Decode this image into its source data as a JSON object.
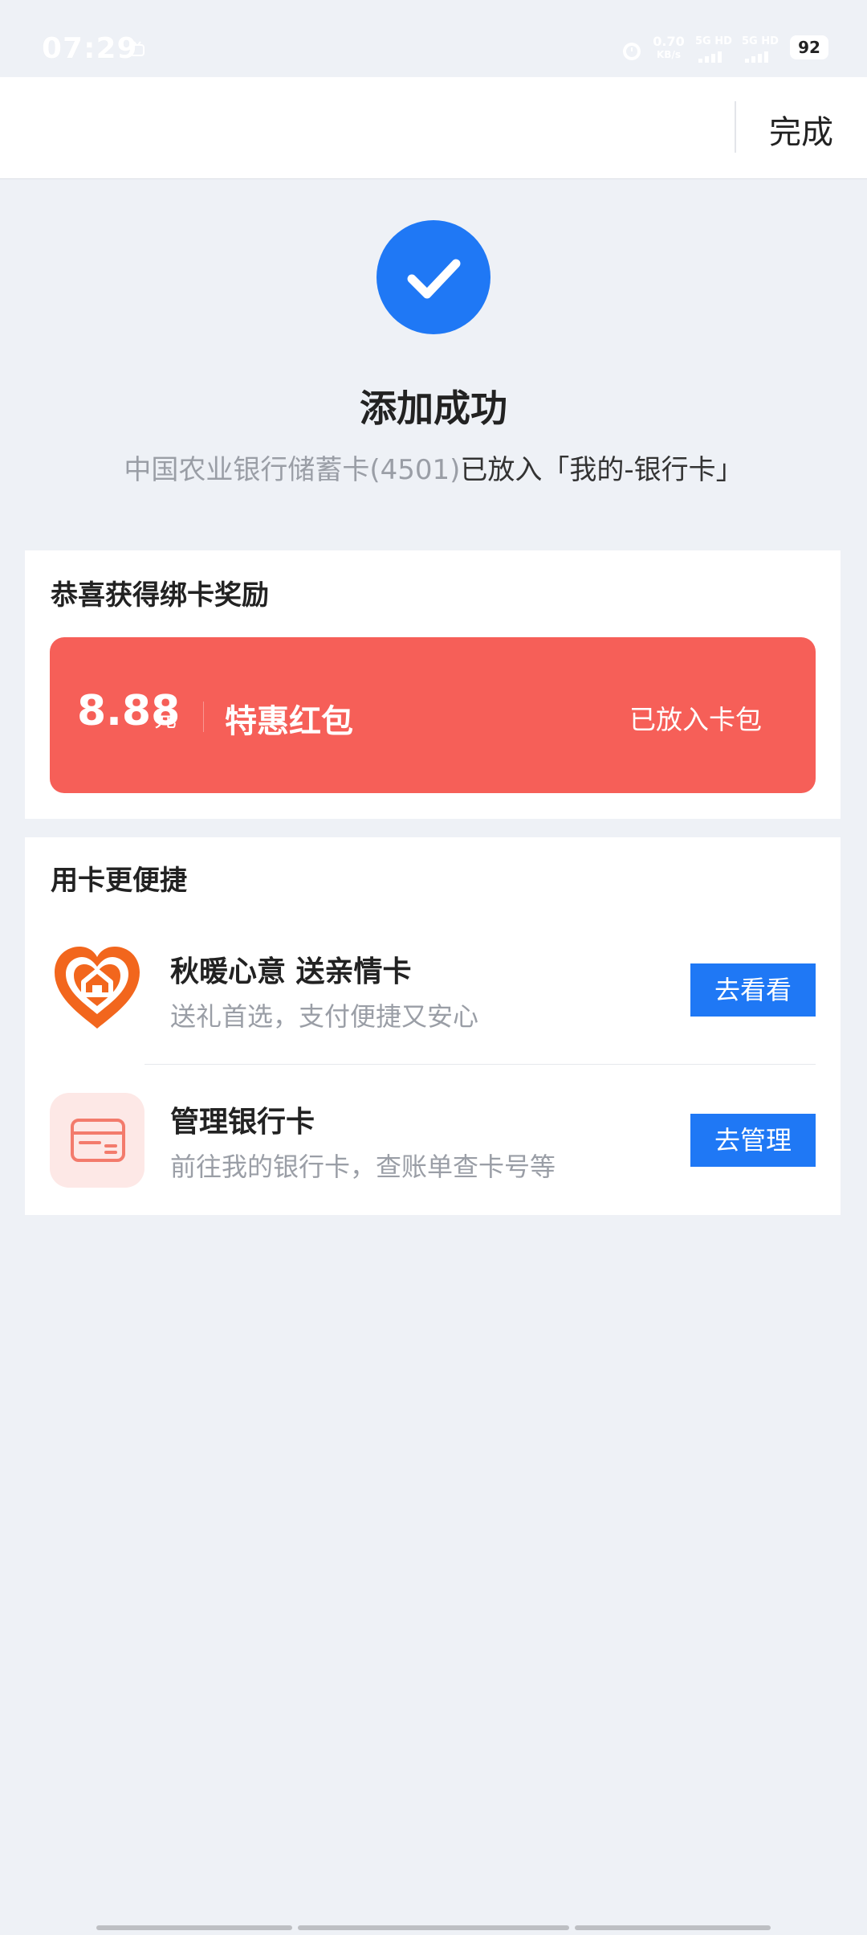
{
  "status_bar": {
    "time": "07:29",
    "net_speed_value": "0.70",
    "net_speed_unit": "KB/s",
    "sim1_label": "5G HD",
    "sim2_label": "5G HD",
    "battery": "92"
  },
  "top_bar": {
    "done_label": "完成"
  },
  "success": {
    "title": "添加成功",
    "desc_grey": "中国农业银行储蓄卡(4501)",
    "desc_dark": "已放入「我的-银行卡」"
  },
  "reward": {
    "title": "恭喜获得绑卡奖励",
    "amount": "8.88",
    "unit": "元",
    "name": "特惠红包",
    "status": "已放入卡包"
  },
  "convenience": {
    "title": "用卡更便捷",
    "items": [
      {
        "title": "秋暖心意 送亲情卡",
        "subtitle": "送礼首选，支付便捷又安心",
        "button": "去看看"
      },
      {
        "title": "管理银行卡",
        "subtitle": "前往我的银行卡，查账单查卡号等",
        "button": "去管理"
      }
    ]
  },
  "colors": {
    "background": "#eef1f6",
    "accent_blue": "#1f78f5",
    "red_packet": "#f65f58",
    "heart_orange": "#f2661d",
    "text_grey": "#9a9ea6"
  },
  "icons": {
    "success": "check-circle-icon",
    "family_card": "heart-house-icon",
    "bank_card": "credit-card-icon"
  }
}
